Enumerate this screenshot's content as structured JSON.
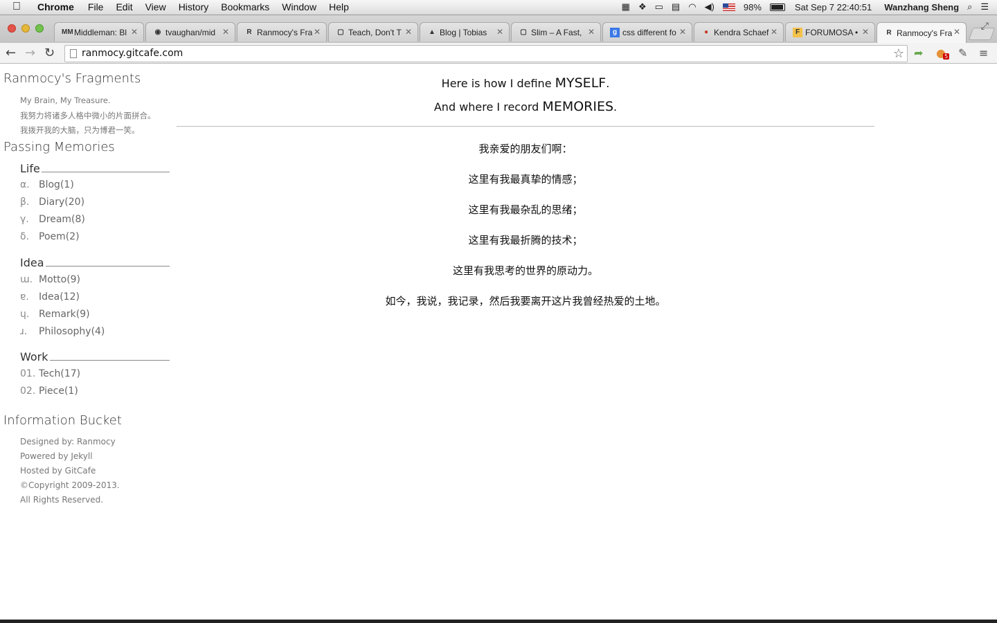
{
  "menubar": {
    "app": "Chrome",
    "items": [
      "File",
      "Edit",
      "View",
      "History",
      "Bookmarks",
      "Window",
      "Help"
    ],
    "battery": "98%",
    "clock": "Sat Sep 7  22:40:51",
    "user": "Wanzhang Sheng"
  },
  "tabs": [
    {
      "fav": "MM",
      "title": "Middleman: Bl"
    },
    {
      "fav": "◉",
      "title": "tvaughan/mid"
    },
    {
      "fav": "R",
      "title": "Ranmocy's Fra"
    },
    {
      "fav": "▢",
      "title": "Teach, Don't T"
    },
    {
      "fav": "▲",
      "title": "Blog | Tobias"
    },
    {
      "fav": "▢",
      "title": "Slim – A Fast, "
    },
    {
      "fav": "g",
      "title": "css different fo"
    },
    {
      "fav": "●",
      "title": "Kendra Schaef"
    },
    {
      "fav": "F",
      "title": "FORUMOSA • ("
    },
    {
      "fav": "R",
      "title": "Ranmocy's Fra"
    }
  ],
  "toolbar": {
    "url": "ranmocy.gitcafe.com",
    "ext_badge": "5"
  },
  "sidebar": {
    "site_title": "Ranmocy's Fragments",
    "taglines": [
      "My Brain, My Treasure.",
      "我努力将诸多人格中微小的片面拼合。",
      "我拨开我的大脑，只为博君一笑。"
    ],
    "passing_title": "Passing Memories",
    "groups": [
      {
        "name": "Life",
        "items": [
          {
            "mark": "α.",
            "label": "Blog(1)"
          },
          {
            "mark": "β.",
            "label": "Diary(20)"
          },
          {
            "mark": "γ.",
            "label": "Dream(8)"
          },
          {
            "mark": "δ.",
            "label": "Poem(2)"
          }
        ]
      },
      {
        "name": "Idea",
        "items": [
          {
            "mark": "ɯ.",
            "label": "Motto(9)"
          },
          {
            "mark": "ɐ.",
            "label": "Idea(12)"
          },
          {
            "mark": "ɥ.",
            "label": "Remark(9)"
          },
          {
            "mark": "ɹ.",
            "label": "Philosophy(4)"
          }
        ]
      },
      {
        "name": "Work",
        "items": [
          {
            "mark": "01.",
            "label": "Tech(17)"
          },
          {
            "mark": "02.",
            "label": "Piece(1)"
          }
        ]
      }
    ],
    "info_title": "Information Bucket",
    "footer": [
      "Designed by: Ranmocy",
      "Powered by Jekyll",
      "Hosted by GitCafe",
      "©Copyright 2009-2013.",
      "All Rights Reserved."
    ]
  },
  "main": {
    "intro1_pre": "Here is how I define ",
    "intro1_big": "MYSELF",
    "intro1_post": ".",
    "intro2_pre": "And where I record ",
    "intro2_big": "MEMORIES",
    "intro2_post": ".",
    "poem": [
      "我亲爱的朋友们啊：",
      "这里有我最真挚的情感；",
      "这里有我最杂乱的思绪；",
      "这里有我最折腾的技术；",
      "这里有我思考的世界的原动力。",
      "如今，我说，我记录，然后我要离开这片我曾经热爱的土地。"
    ]
  }
}
